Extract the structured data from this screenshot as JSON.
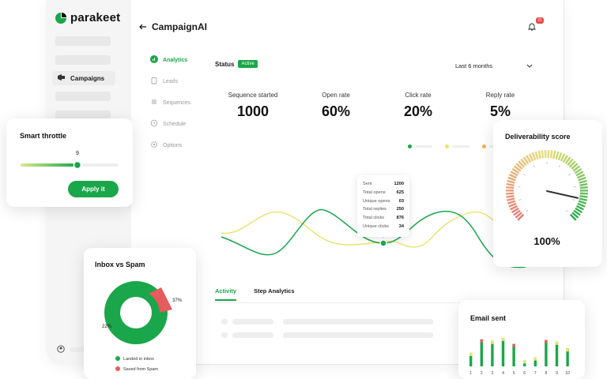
{
  "brand": {
    "name": "parakeet",
    "accent": "#1aa64a",
    "yellow": "#e6e56a",
    "orange": "#f2b443",
    "red": "#e55c5c"
  },
  "sidebar": {
    "active_item": "Campaigns"
  },
  "header": {
    "title": "CampaignAI",
    "notification_count": "21"
  },
  "sub_nav": [
    {
      "label": "Analytics",
      "icon": "bar-chart-icon",
      "active": true
    },
    {
      "label": "Leads",
      "icon": "clipboard-icon",
      "active": false
    },
    {
      "label": "Sequences",
      "icon": "list-icon",
      "active": false
    },
    {
      "label": "Schedule",
      "icon": "clock-icon",
      "active": false
    },
    {
      "label": "Options",
      "icon": "gear-icon",
      "active": false
    }
  ],
  "status": {
    "label": "Status",
    "badge": "Active"
  },
  "range": {
    "selected": "Last 6 months"
  },
  "stats": [
    {
      "label": "Sequence started",
      "value": "1000"
    },
    {
      "label": "Open rate",
      "value": "60%"
    },
    {
      "label": "Click rate",
      "value": "20%"
    },
    {
      "label": "Reply rate",
      "value": "5%"
    }
  ],
  "tooltip": [
    {
      "label": "Sent",
      "value": "1200"
    },
    {
      "label": "Total opens",
      "value": "625"
    },
    {
      "label": "Unique opens",
      "value": "03"
    },
    {
      "label": "Total replies",
      "value": "250"
    },
    {
      "label": "Total clicks",
      "value": "876"
    },
    {
      "label": "Unique clicks",
      "value": "34"
    }
  ],
  "tabs": [
    {
      "label": "Activity",
      "active": true
    },
    {
      "label": "Step Analytics",
      "active": false
    }
  ],
  "throttle": {
    "title": "Smart throttle",
    "value": "9",
    "level": 0.58,
    "apply_label": "Apply it"
  },
  "inbox_spam": {
    "title": "Inbox vs Spam",
    "inbox_pct": 22,
    "spam_pct": 37,
    "inbox_label": "22%",
    "spam_label": "37%",
    "legend_inbox": "Landed in inbox",
    "legend_spam": "Saved from Spam"
  },
  "deliverability": {
    "title": "Deliverability score",
    "value": "100%",
    "level": 1.0
  },
  "email_sent": {
    "title": "Email sent",
    "categories": [
      "1",
      "2",
      "3",
      "4",
      "5",
      "6",
      "7",
      "8",
      "9",
      "10"
    ],
    "values": [
      0.45,
      0.9,
      0.85,
      0.95,
      0.75,
      0.2,
      0.3,
      0.88,
      0.82,
      0.6
    ]
  }
}
